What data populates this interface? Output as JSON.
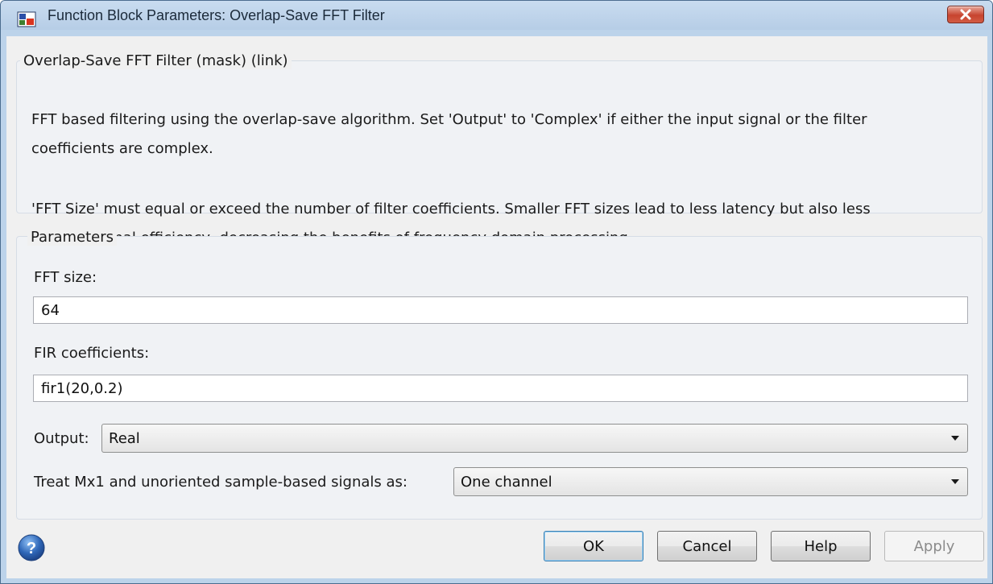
{
  "window": {
    "title": "Function Block Parameters: Overlap-Save FFT Filter",
    "icons": {
      "app": "simulink-block-icon",
      "close": "close-icon"
    }
  },
  "description_group": {
    "label": "Overlap-Save FFT Filter (mask) (link)",
    "paragraphs": [
      {
        "line1": "FFT based filtering using the overlap-save algorithm.  Set 'Output' to 'Complex' if either the input signal or the filter",
        "line2": "coefficients are complex."
      },
      {
        "line1": "'FFT Size' must equal or exceed the number of filter coefficients.  Smaller FFT sizes lead to less latency but also less",
        "line2": "computational efficiency, decreasing the benefits of frequency domain processing."
      }
    ]
  },
  "parameters": {
    "label": "Parameters",
    "fft_size": {
      "label": "FFT size:",
      "value": "64"
    },
    "fir_coefficients": {
      "label": "FIR coefficients:",
      "value": "fir1(20,0.2)"
    },
    "output": {
      "label": "Output:",
      "value": "Real"
    },
    "treat_mx1": {
      "label": "Treat Mx1 and unoriented sample-based signals as:",
      "value": "One channel"
    }
  },
  "buttons": {
    "ok": "OK",
    "cancel": "Cancel",
    "help": "Help",
    "apply": "Apply"
  },
  "help_icon": "help-circle-icon",
  "colors": {
    "titlebar": "#bcd3ea",
    "dialog_background": "#f0f0f0",
    "close_button": "#c7442f",
    "help_icon": "#2f67b8"
  }
}
